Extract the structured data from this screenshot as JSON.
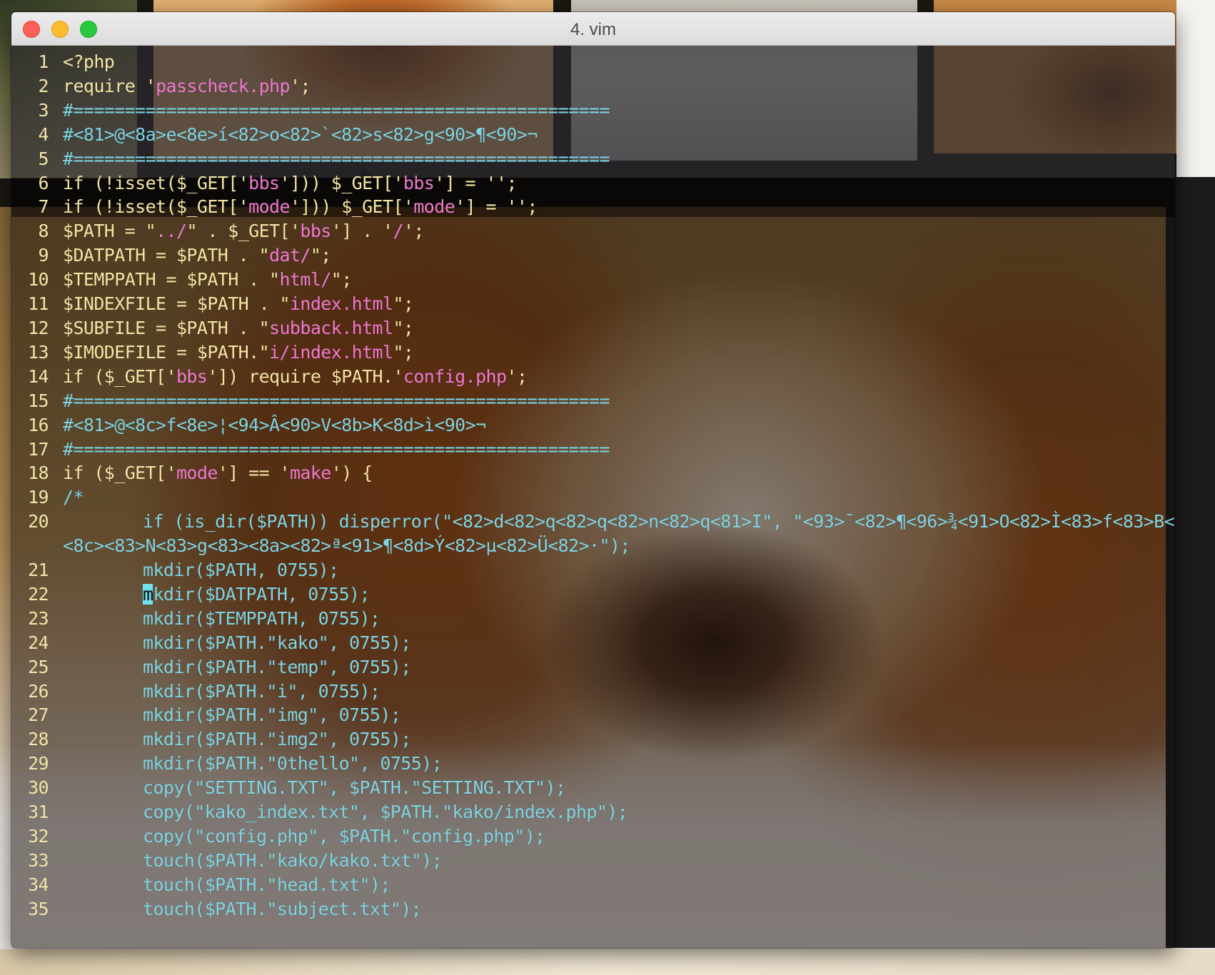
{
  "window": {
    "title": "4. vim",
    "buttons": {
      "close": "close",
      "minimize": "minimize",
      "zoom": "zoom"
    }
  },
  "editor": {
    "lines": [
      {
        "n": "1",
        "t": "<?php"
      },
      {
        "n": "2",
        "t": "require 'passcheck.php';"
      },
      {
        "n": "3",
        "t": "#===================================================="
      },
      {
        "n": "4",
        "t": "#<81>@<8a>e<8e>í<82>o<82>`<82>s<82>g<90>¶<90>¬"
      },
      {
        "n": "5",
        "t": "#===================================================="
      },
      {
        "n": "6",
        "t": "if (!isset($_GET['bbs'])) $_GET['bbs'] = '';"
      },
      {
        "n": "7",
        "t": "if (!isset($_GET['mode'])) $_GET['mode'] = '';"
      },
      {
        "n": "8",
        "t": "$PATH = \"../\" . $_GET['bbs'] . '/';"
      },
      {
        "n": "9",
        "t": "$DATPATH = $PATH . \"dat/\";"
      },
      {
        "n": "10",
        "t": "$TEMPPATH = $PATH . \"html/\";"
      },
      {
        "n": "11",
        "t": "$INDEXFILE = $PATH . \"index.html\";"
      },
      {
        "n": "12",
        "t": "$SUBFILE = $PATH . \"subback.html\";"
      },
      {
        "n": "13",
        "t": "$IMODEFILE = $PATH.\"i/index.html\";"
      },
      {
        "n": "14",
        "t": "if ($_GET['bbs']) require $PATH.'config.php';"
      },
      {
        "n": "15",
        "t": "#===================================================="
      },
      {
        "n": "16",
        "t": "#<81>@<8c>f<8e>¦<94>Â<90>V<8b>K<8d>ì<90>¬"
      },
      {
        "n": "17",
        "t": "#===================================================="
      },
      {
        "n": "18",
        "t": "if ($_GET['mode'] == 'make') {"
      },
      {
        "n": "19",
        "t": "/*"
      },
      {
        "n": "20",
        "t": "if (is_dir($PATH)) disperror(\"<82>d<82>q<82>q<82>n<82>q<81>I\", \"<93>¯<82>¶<96>¾<91>O<82>Ì<83>f<83>B<83>"
      },
      {
        "n": "",
        "t": "<8c><83>N<83>g<83><8a><82>ª<91>¶<8d>Ý<82>µ<82>Ü<82>·\");"
      },
      {
        "n": "21",
        "t": "mkdir($PATH, 0755);"
      },
      {
        "n": "22",
        "t": "mkdir($DATPATH, 0755);"
      },
      {
        "n": "23",
        "t": "mkdir($TEMPPATH, 0755);"
      },
      {
        "n": "24",
        "t": "mkdir($PATH.\"kako\", 0755);"
      },
      {
        "n": "25",
        "t": "mkdir($PATH.\"temp\", 0755);"
      },
      {
        "n": "26",
        "t": "mkdir($PATH.\"i\", 0755);"
      },
      {
        "n": "27",
        "t": "mkdir($PATH.\"img\", 0755);"
      },
      {
        "n": "28",
        "t": "mkdir($PATH.\"img2\", 0755);"
      },
      {
        "n": "29",
        "t": "mkdir($PATH.\"0thello\", 0755);"
      },
      {
        "n": "30",
        "t": "copy(\"SETTING.TXT\", $PATH.\"SETTING.TXT\");"
      },
      {
        "n": "31",
        "t": "copy(\"kako_index.txt\", $PATH.\"kako/index.php\");"
      },
      {
        "n": "32",
        "t": "copy(\"config.php\", $PATH.\"config.php\");"
      },
      {
        "n": "33",
        "t": "touch($PATH.\"kako/kako.txt\");"
      },
      {
        "n": "34",
        "t": "touch($PATH.\"head.txt\");"
      },
      {
        "n": "35",
        "t": "touch($PATH.\"subject.txt\");"
      }
    ]
  },
  "colors": {
    "keyword": "#f4e4a4",
    "comment": "#7fd4e3",
    "string": "#f07ad0",
    "cursor": "#6fe1f1"
  }
}
